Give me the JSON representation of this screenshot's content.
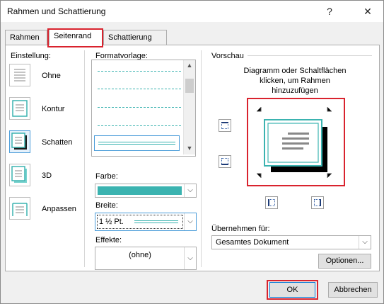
{
  "window": {
    "title": "Rahmen und Schattierung",
    "help_glyph": "?",
    "close_glyph": "✕"
  },
  "tabs": [
    {
      "label": "Rahmen",
      "active": false
    },
    {
      "label": "Seitenrand",
      "active": true
    },
    {
      "label": "Schattierung",
      "active": false
    }
  ],
  "settings": {
    "heading": "Einstellung:",
    "items": [
      {
        "label": "Ohne",
        "selected": false
      },
      {
        "label": "Kontur",
        "selected": false
      },
      {
        "label": "Schatten",
        "selected": true
      },
      {
        "label": "3D",
        "selected": false
      },
      {
        "label": "Anpassen",
        "selected": false
      }
    ]
  },
  "style": {
    "heading": "Formatvorlage:",
    "options_count_visible": 5
  },
  "color": {
    "label": "Farbe:",
    "value_hex": "#3bb3b0"
  },
  "width": {
    "label": "Breite:",
    "value": "1 ½ Pt."
  },
  "effects": {
    "label": "Effekte:",
    "value": "(ohne)"
  },
  "preview": {
    "heading": "Vorschau",
    "instructions_line1": "Diagramm oder Schaltflächen",
    "instructions_line2": "klicken, um Rahmen",
    "instructions_line3": "hinzuzufügen"
  },
  "apply": {
    "label": "Übernehmen für:",
    "value": "Gesamtes Dokument"
  },
  "buttons": {
    "options": "Optionen...",
    "ok": "OK",
    "cancel": "Abbrechen"
  },
  "colors": {
    "highlight": "#d9232e",
    "accent": "#3bb3b0",
    "selection": "#4a9cd9"
  }
}
